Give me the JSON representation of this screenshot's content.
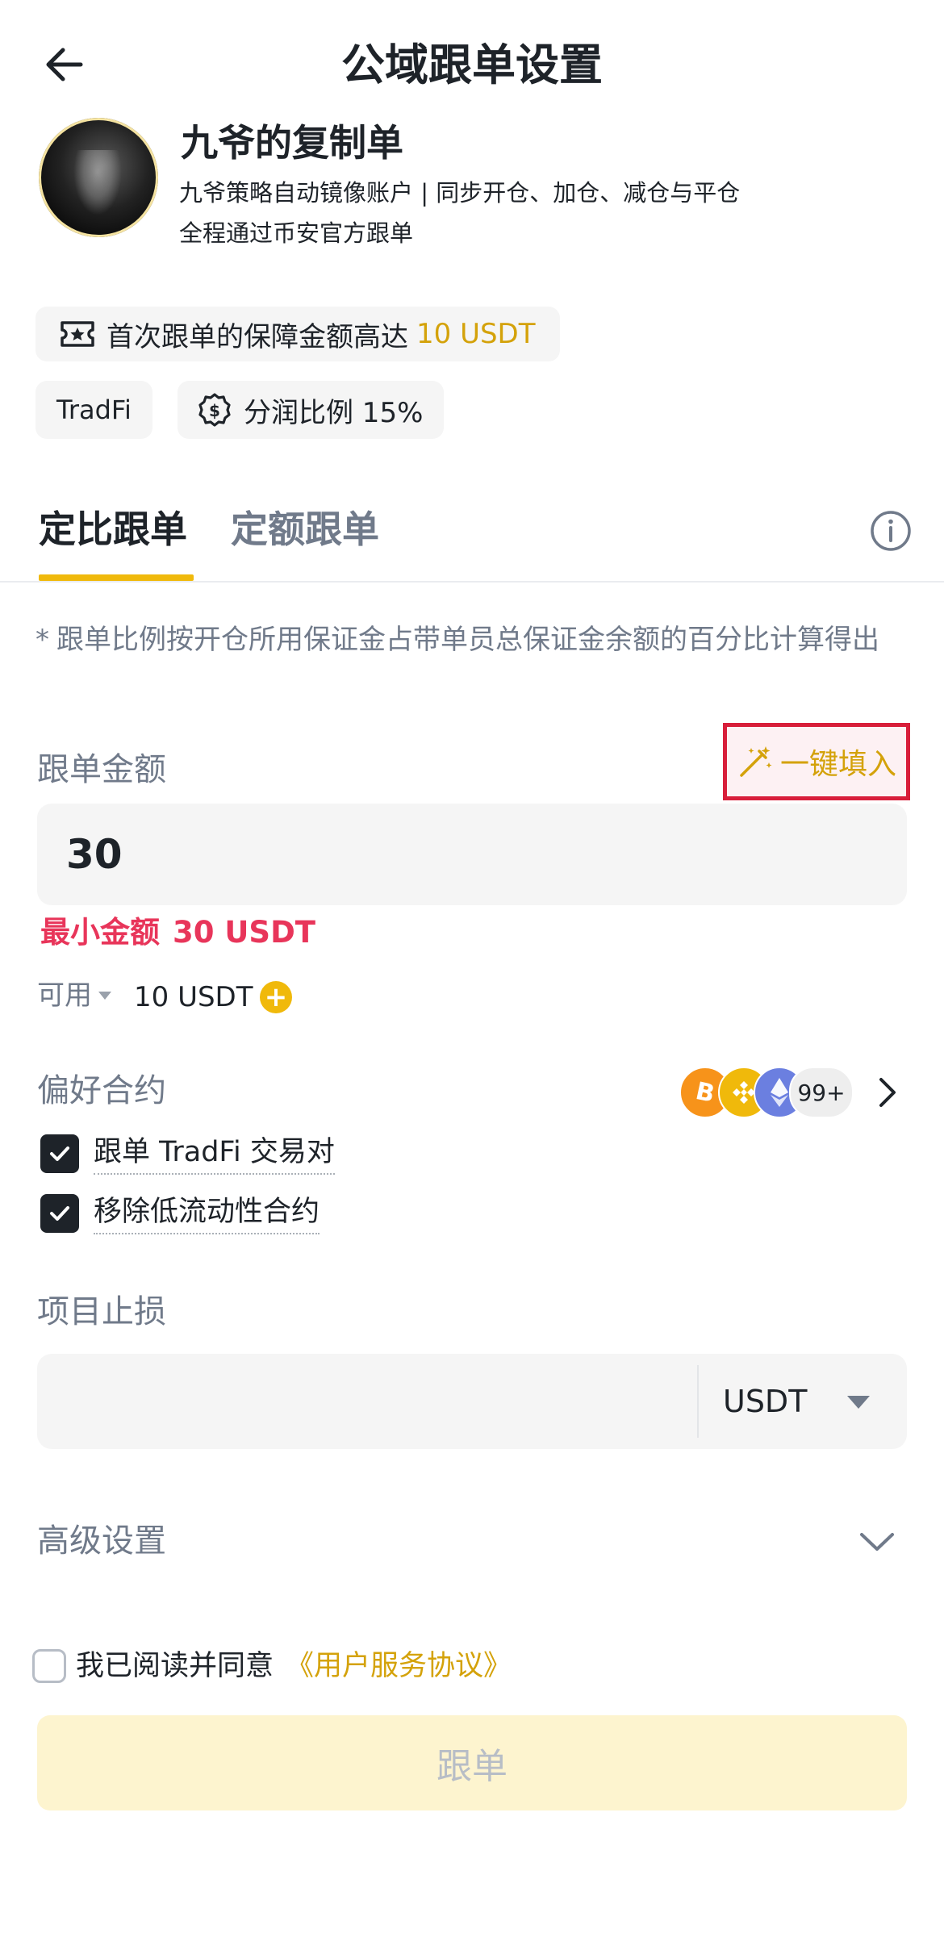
{
  "header": {
    "title": "公域跟单设置"
  },
  "profile": {
    "name": "九爷的复制单",
    "description": "九爷策略自动镜像账户 | 同步开仓、加仓、减仓与平仓",
    "description_line2": "全程通过币安官方跟单"
  },
  "chips": {
    "guarantee_text": "首次跟单的保障金额高达",
    "guarantee_amount": "10 USDT",
    "tradfi": "TradFi",
    "profit_share": "分润比例 15%"
  },
  "tabs": [
    {
      "label": "定比跟单",
      "active": true
    },
    {
      "label": "定额跟单",
      "active": false
    }
  ],
  "note": {
    "star": "*",
    "text": "跟单比例按开仓所用保证金占带单员总保证金余额的百分比计算得出"
  },
  "amount": {
    "label": "跟单金额",
    "autofill_label": "一键填入",
    "value": "30",
    "min_label": "最小金额",
    "min_value": "30 USDT",
    "available_label": "可用",
    "available_value": "10 USDT",
    "add_symbol": "+"
  },
  "preferred": {
    "label": "偏好合约",
    "coins": [
      "BTC",
      "BNB",
      "ETH"
    ],
    "more_count": "99+",
    "options": [
      {
        "label": "跟单 TradFi 交易对",
        "checked": true
      },
      {
        "label": "移除低流动性合约",
        "checked": true
      }
    ]
  },
  "stop_loss": {
    "label": "项目止损",
    "value": "",
    "unit": "USDT"
  },
  "advanced": {
    "label": "高级设置"
  },
  "agreement": {
    "text": "我已阅读并同意",
    "link": "《用户服务协议》",
    "checked": false
  },
  "submit": {
    "label": "跟单"
  },
  "colors": {
    "accent": "#f0b90b",
    "accent_text": "#d4a20a",
    "error": "#e8355a",
    "highlight_border": "#d81e3a"
  }
}
